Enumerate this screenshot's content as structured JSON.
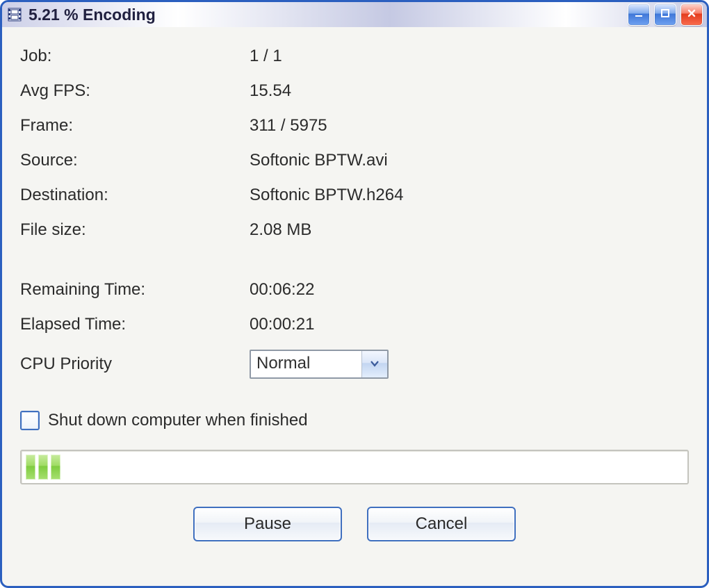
{
  "window": {
    "title": "5.21 % Encoding"
  },
  "info": {
    "labels": {
      "job": "Job:",
      "avg_fps": "Avg FPS:",
      "frame": "Frame:",
      "source": "Source:",
      "destination": "Destination:",
      "file_size": "File size:",
      "remaining_time": "Remaining Time:",
      "elapsed_time": "Elapsed Time:",
      "cpu_priority": "CPU Priority"
    },
    "values": {
      "job": "1 / 1",
      "avg_fps": "15.54",
      "frame": "311 / 5975",
      "source": "Softonic BPTW.avi",
      "destination": "Softonic BPTW.h264",
      "file_size": "2.08 MB",
      "remaining_time": "00:06:22",
      "elapsed_time": "00:00:21"
    }
  },
  "cpu_priority": {
    "selected": "Normal"
  },
  "shutdown": {
    "label": "Shut down computer when finished",
    "checked": false
  },
  "progress": {
    "percent": 5.21,
    "segments": 3
  },
  "buttons": {
    "pause": "Pause",
    "cancel": "Cancel"
  }
}
